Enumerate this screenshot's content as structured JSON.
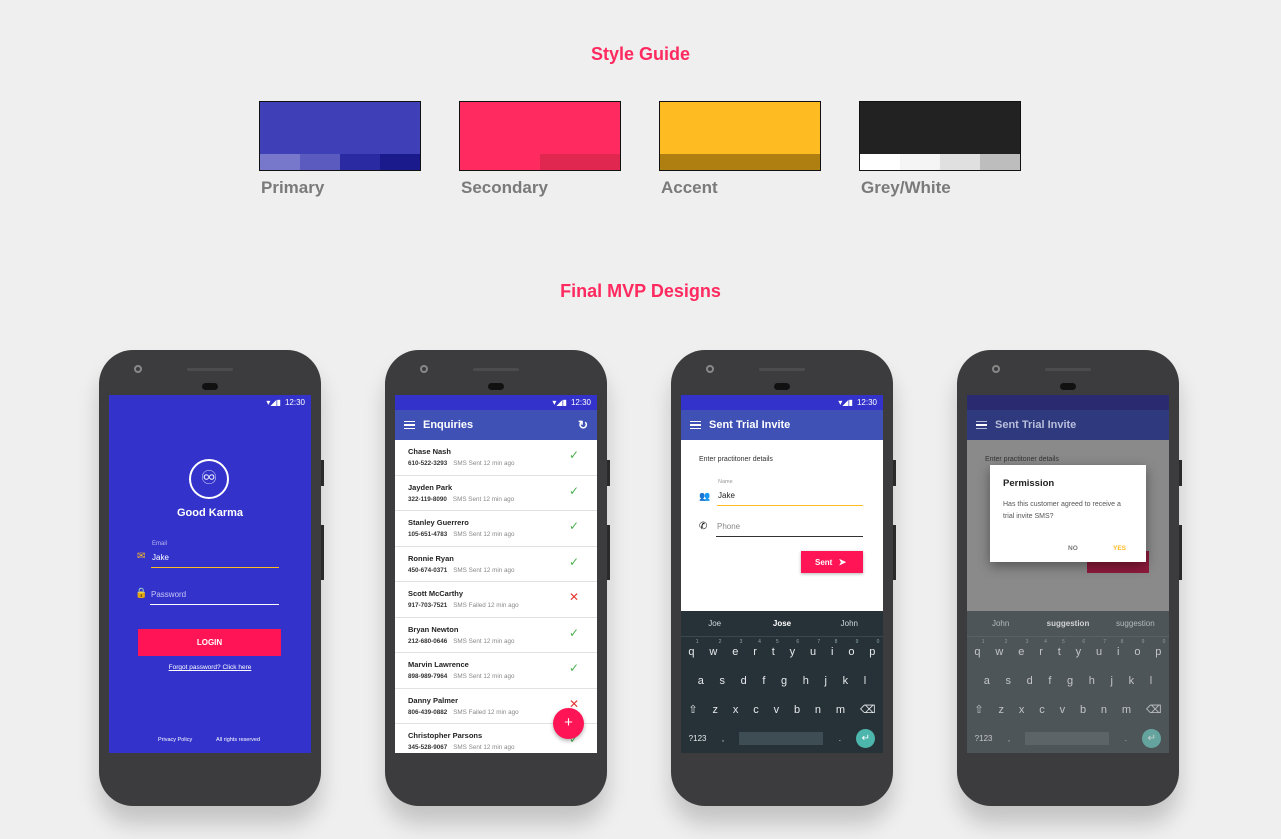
{
  "headings": {
    "style_guide": "Style Guide",
    "final": "Final MVP Designs"
  },
  "palette": [
    {
      "label": "Primary",
      "main": "#3f3fb8",
      "shades": [
        "#7777cc",
        "#5a5abf",
        "#2a2aa2",
        "#1a1a8c"
      ]
    },
    {
      "label": "Secondary",
      "main": "#ff2a5f",
      "shades": [
        "#ff2a5f",
        "#ff2a5f",
        "#e0274f",
        "#e0274f"
      ]
    },
    {
      "label": "Accent",
      "main": "#ffbb22",
      "shades": [
        "#b07f12",
        "#b07f12",
        "#b07f12",
        "#b07f12"
      ]
    },
    {
      "label": "Grey/White",
      "main": "#222222",
      "shades": [
        "#ffffff",
        "#f5f5f5",
        "#e0e0e0",
        "#bdbdbd"
      ]
    }
  ],
  "status": {
    "time": "12:30"
  },
  "login": {
    "app_name": "Good Karma",
    "email_label": "Email",
    "email_value": "Jake",
    "password_placeholder": "Password",
    "login_button": "LOGIN",
    "forgot": "Forgot password? Click here",
    "privacy": "Privacy Policy",
    "rights": "All rights reserved"
  },
  "enquiries": {
    "title": "Enquiries",
    "fab": "+",
    "rows": [
      {
        "name": "Chase Nash",
        "phone": "610-522-3293",
        "status": "SMS Sent 12 min ago",
        "ok": true
      },
      {
        "name": "Jayden Park",
        "phone": "322-119-8090",
        "status": "SMS Sent 12 min ago",
        "ok": true
      },
      {
        "name": "Stanley Guerrero",
        "phone": "105-651-4783",
        "status": "SMS Sent 12 min ago",
        "ok": true
      },
      {
        "name": "Ronnie Ryan",
        "phone": "450-674-0371",
        "status": "SMS Sent 12 min ago",
        "ok": true
      },
      {
        "name": "Scott McCarthy",
        "phone": "917-703-7521",
        "status": "SMS Failed 12 min ago",
        "ok": false
      },
      {
        "name": "Bryan Newton",
        "phone": "212-680-0646",
        "status": "SMS Sent 12 min ago",
        "ok": true
      },
      {
        "name": "Marvin Lawrence",
        "phone": "898-989-7964",
        "status": "SMS Sent 12 min ago",
        "ok": true
      },
      {
        "name": "Danny Palmer",
        "phone": "806-439-0882",
        "status": "SMS Failed 12 min ago",
        "ok": false
      },
      {
        "name": "Christopher Parsons",
        "phone": "345-528-9067",
        "status": "SMS Sent 12 min ago",
        "ok": true
      }
    ]
  },
  "invite": {
    "title": "Sent Trial Invite",
    "prompt": "Enter practitoner details",
    "name_label": "Name",
    "name_value": "Jake",
    "phone_placeholder": "Phone",
    "sent_button": "Sent",
    "suggestions": [
      "Joe",
      "Jose",
      "John"
    ]
  },
  "permission": {
    "title": "Permission",
    "body": "Has this customer agreed to receive a trial invite SMS?",
    "no": "NO",
    "yes": "YES",
    "suggestions": [
      "John",
      "suggestion",
      "suggestion"
    ]
  },
  "keyboard": {
    "row1": [
      "q",
      "w",
      "e",
      "r",
      "t",
      "y",
      "u",
      "i",
      "o",
      "p"
    ],
    "row1_nums": [
      "1",
      "2",
      "3",
      "4",
      "5",
      "6",
      "7",
      "8",
      "9",
      "0"
    ],
    "row2": [
      "a",
      "s",
      "d",
      "f",
      "g",
      "h",
      "j",
      "k",
      "l"
    ],
    "row3": [
      "z",
      "x",
      "c",
      "v",
      "b",
      "n",
      "m"
    ],
    "sym": "?123",
    "comma": ",",
    "period": "."
  }
}
